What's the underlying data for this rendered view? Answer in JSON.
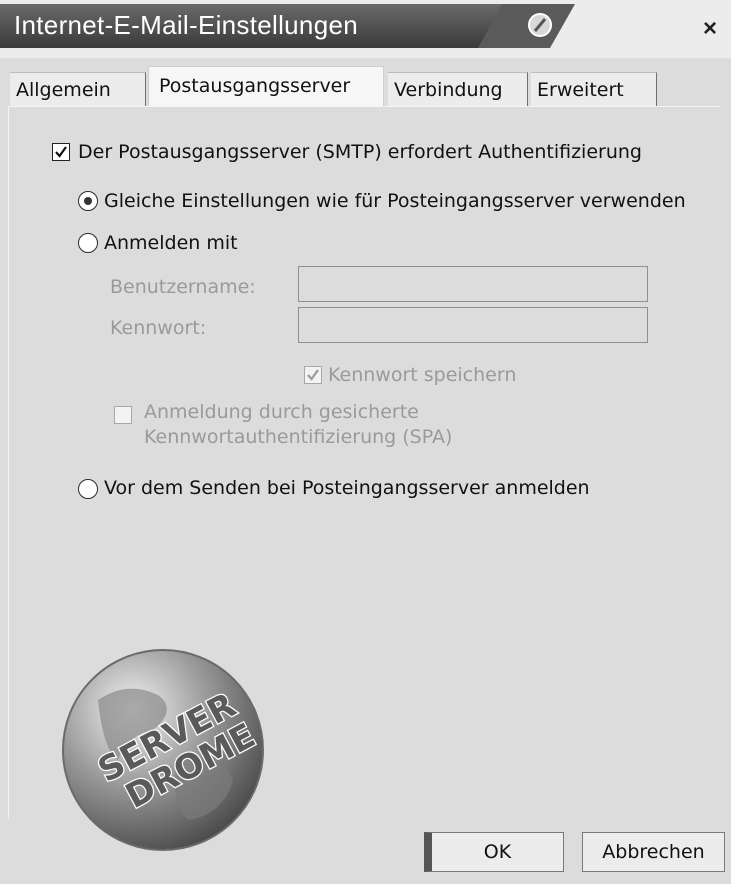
{
  "window": {
    "title": "Internet-E-Mail-Einstellungen",
    "close_glyph": "×"
  },
  "tabs": [
    {
      "label": "Allgemein",
      "active": false
    },
    {
      "label": "Postausgangsserver",
      "active": true
    },
    {
      "label": "Verbindung",
      "active": false
    },
    {
      "label": "Erweitert",
      "active": false
    }
  ],
  "smtp_auth": {
    "label": "Der Postausgangsserver (SMTP) erfordert Authentifizierung",
    "checked": true
  },
  "options": {
    "same_settings": {
      "label": "Gleiche Einstellungen wie für Posteingangsserver verwenden",
      "selected": true
    },
    "login_with": {
      "label": "Anmelden mit",
      "selected": false
    },
    "login_before_send": {
      "label": "Vor dem Senden bei Posteingangsserver anmelden",
      "selected": false
    }
  },
  "credentials": {
    "username_label": "Benutzername:",
    "username_value": "",
    "password_label": "Kennwort:",
    "password_value": "",
    "save_password_label": "Kennwort speichern",
    "save_password_checked": true,
    "spa_label_line1": "Anmeldung durch gesicherte",
    "spa_label_line2": "Kennwortauthentifizierung (SPA)",
    "spa_checked": false
  },
  "logo": {
    "line1": "SERVER",
    "line2": "DROME"
  },
  "buttons": {
    "ok": "OK",
    "cancel": "Abbrechen"
  },
  "colors": {
    "titlebar": "#4a4a4a",
    "dialog_bg": "#dcdcdc"
  }
}
